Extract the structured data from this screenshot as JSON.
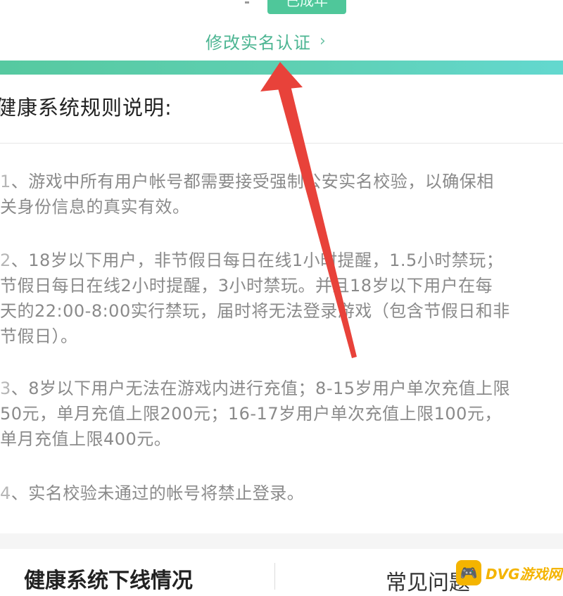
{
  "status": {
    "badge": "已成年"
  },
  "link": {
    "label": "修改实名认证",
    "chevron": "›"
  },
  "rules": {
    "title": "健康系统规则说明:",
    "items": [
      {
        "num": "1",
        "lines": [
          "、游戏中所有用户帐号都需要接受强制公安实名校验，以确保相",
          "关身份信息的真实有效。"
        ]
      },
      {
        "num": "2",
        "lines": [
          "、18岁以下用户，非节假日每日在线1小时提醒，1.5小时禁玩；",
          "节假日每日在线2小时提醒，3小时禁玩。并且18岁以下用户在每",
          "天的22:00-8:00实行禁玩，届时将无法登录游戏（包含节假日和非",
          "节假日）。"
        ]
      },
      {
        "num": "3",
        "lines": [
          "、8岁以下用户无法在游戏内进行充值；8-15岁用户单次充值上限",
          "50元，单月充值上限200元；16-17岁用户单次充值上限100元，",
          "单月充值上限400元。"
        ]
      },
      {
        "num": "4",
        "lines": [
          "、实名校验未通过的帐号将禁止登录。"
        ]
      }
    ]
  },
  "tabs": {
    "left": "健康系统下线情况",
    "right": "常见问题"
  },
  "watermark": {
    "logo": "🎮",
    "text": "DVG游戏网"
  },
  "colors": {
    "accent": "#4cb592",
    "arrow": "#e8423a"
  }
}
